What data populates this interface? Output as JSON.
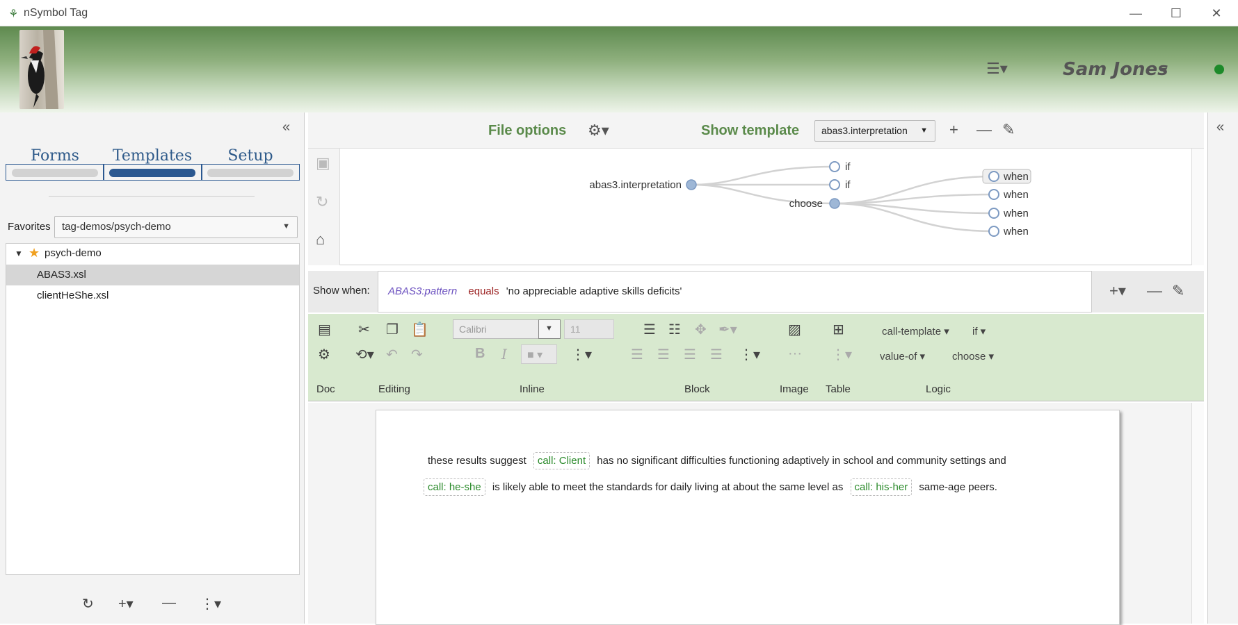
{
  "window": {
    "title": "nSymbol Tag",
    "minimize": "—",
    "maximize": "☐",
    "close": "✕"
  },
  "header": {
    "user_name": "Sam Jones",
    "status_color": "#1d8a2a"
  },
  "left": {
    "tabs": [
      {
        "label": "Forms",
        "active": false
      },
      {
        "label": "Templates",
        "active": true
      },
      {
        "label": "Setup",
        "active": false
      }
    ],
    "favorites_label": "Favorites",
    "favorites_value": "tag-demos/psych-demo",
    "tree": {
      "folder": "psych-demo",
      "files": [
        "ABAS3.xsl",
        "clientHeShe.xsl"
      ],
      "selected": "ABAS3.xsl"
    }
  },
  "topbar": {
    "file_options": "File options",
    "show_template": "Show template",
    "template_value": "abas3.interpretation"
  },
  "diagram": {
    "root": "abas3.interpretation",
    "children": [
      "if",
      "if",
      "choose"
    ],
    "choose_children": [
      "when",
      "when",
      "when",
      "when"
    ]
  },
  "show_when": {
    "label": "Show when:",
    "variable": "ABAS3:pattern",
    "operator": "equals",
    "value": "'no appreciable adaptive skills deficits'"
  },
  "ribbon": {
    "font": "Calibri",
    "size": "11",
    "groups": [
      "Doc",
      "Editing",
      "Inline",
      "Block",
      "Image",
      "Table",
      "Logic"
    ],
    "logic_buttons": [
      "call-template",
      "if",
      "value-of",
      "choose"
    ]
  },
  "document": {
    "line1_pre": "these results suggest",
    "chip1": "call: Client",
    "line1_post": "has no significant difficulties functioning adaptively in school and community settings and",
    "chip2": "call: he-she",
    "line2_mid": "is likely able to meet the standards for daily living at about the same level as",
    "chip3": "call: his-her",
    "line2_post": "same-age peers."
  },
  "colors": {
    "accent_green": "#5a8a4a",
    "tab_blue": "#2b5890",
    "ribbon_bg": "#d8e9cf"
  }
}
